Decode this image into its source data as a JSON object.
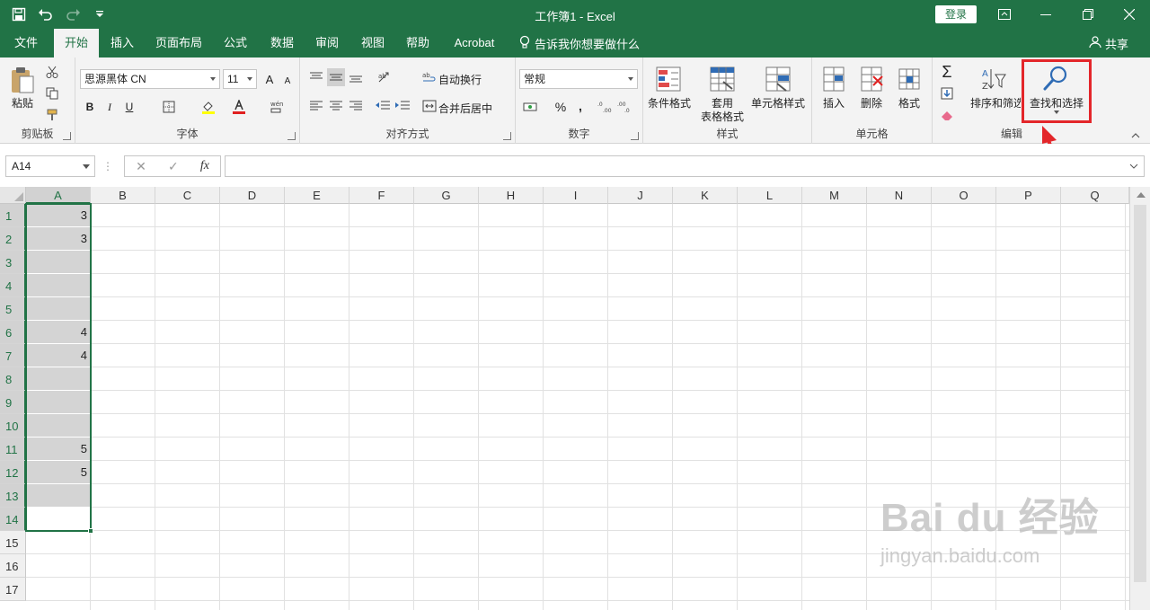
{
  "titlebar": {
    "title": "工作簿1  -  Excel",
    "login": "登录",
    "qat": {
      "save_icon": "save-icon",
      "undo_icon": "undo-icon",
      "redo_icon": "redo-icon",
      "customize_icon": "customize-qat-icon"
    }
  },
  "tabs": [
    "文件",
    "开始",
    "插入",
    "页面布局",
    "公式",
    "数据",
    "审阅",
    "视图",
    "帮助",
    "Acrobat"
  ],
  "active_tab": "开始",
  "tell_me": "告诉我你想要做什么",
  "share": "共享",
  "ribbon": {
    "clipboard": {
      "label": "剪贴板",
      "paste": "粘贴"
    },
    "font": {
      "label": "字体",
      "font_name": "思源黑体 CN",
      "font_size": "11",
      "bold": "B",
      "italic": "I",
      "underline": "U",
      "grow": "A",
      "shrink": "A"
    },
    "alignment": {
      "label": "对齐方式",
      "wrap": "自动换行",
      "merge": "合并后居中"
    },
    "number": {
      "label": "数字",
      "format": "常规",
      "percent": "%",
      "comma": ","
    },
    "styles": {
      "label": "样式",
      "conditional": "条件格式",
      "table_format_1": "套用",
      "table_format_2": "表格格式",
      "cell_styles": "单元格样式"
    },
    "cells": {
      "label": "单元格",
      "insert": "插入",
      "delete": "删除",
      "format": "格式"
    },
    "editing": {
      "label": "编辑",
      "sort_filter": "排序和筛选",
      "find_select": "查找和选择"
    }
  },
  "formula_bar": {
    "name_box": "A14",
    "fx": "fx",
    "content": ""
  },
  "columns": [
    "A",
    "B",
    "C",
    "D",
    "E",
    "F",
    "G",
    "H",
    "I",
    "J",
    "K",
    "L",
    "M",
    "N",
    "O",
    "P",
    "Q"
  ],
  "rows": [
    "1",
    "2",
    "3",
    "4",
    "5",
    "6",
    "7",
    "8",
    "9",
    "10",
    "11",
    "12",
    "13",
    "14",
    "15",
    "16",
    "17"
  ],
  "columnA": [
    "3",
    "3",
    "",
    "",
    "",
    "4",
    "4",
    "",
    "",
    "",
    "5",
    "5",
    "",
    ""
  ],
  "active_cell": "A14",
  "watermark": {
    "logo": "Bai du 经验",
    "sub": "jingyan.baidu.com"
  },
  "colors": {
    "accent": "#217346",
    "highlight": "#e3262a",
    "selection_fill": "#d4d4d4"
  }
}
